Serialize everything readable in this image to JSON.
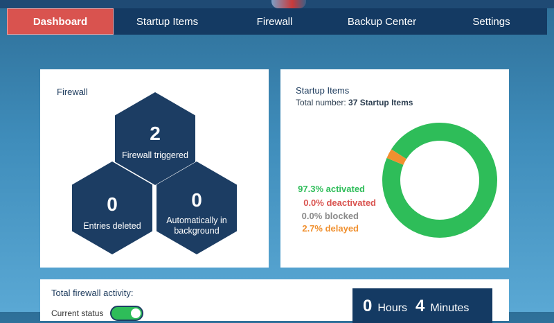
{
  "nav": {
    "tabs": [
      {
        "label": "Dashboard",
        "active": true
      },
      {
        "label": "Startup Items",
        "active": false
      },
      {
        "label": "Firewall",
        "active": false
      },
      {
        "label": "Backup Center",
        "active": false
      },
      {
        "label": "Settings",
        "active": false
      }
    ]
  },
  "firewall": {
    "title": "Firewall",
    "triggered": {
      "value": "2",
      "label": "Firewall triggered"
    },
    "entries_deleted": {
      "value": "0",
      "label": "Entries deleted"
    },
    "auto_background": {
      "value": "0",
      "label": "Automatically in background"
    }
  },
  "startup": {
    "title": "Startup Items",
    "total_label": "Total number:",
    "total_value": "37 Startup Items",
    "legend": {
      "activated": "97.3% activated",
      "deactivated": "0.0% deactivated",
      "blocked": "0.0% blocked",
      "delayed": "2.7% delayed"
    }
  },
  "chart_data": {
    "type": "pie",
    "categories": [
      "activated",
      "deactivated",
      "blocked",
      "delayed"
    ],
    "values": [
      97.3,
      0.0,
      0.0,
      2.7
    ],
    "colors": [
      "#2ebd59",
      "#d9534f",
      "#8a8a8a",
      "#f0902f"
    ],
    "donut": true
  },
  "activity": {
    "title": "Total firewall activity:",
    "status_label": "Current status",
    "toggle_on": true
  },
  "timer": {
    "hours": "0",
    "hours_unit": "Hours",
    "minutes": "4",
    "minutes_unit": "Minutes"
  }
}
